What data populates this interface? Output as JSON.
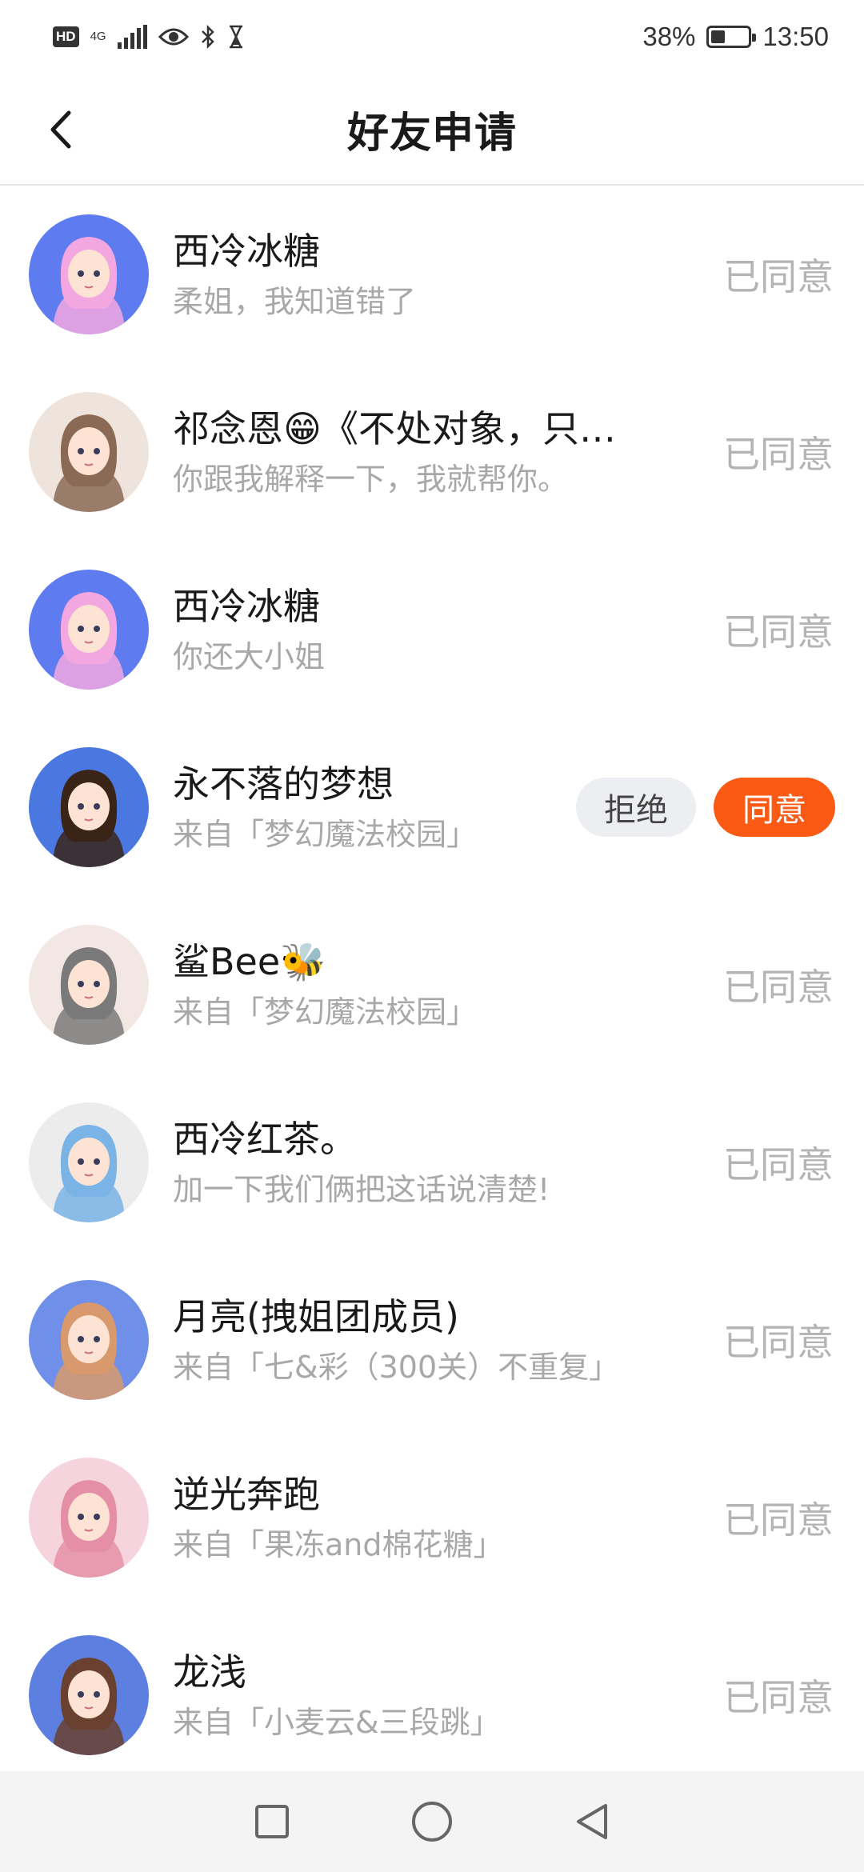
{
  "status_bar": {
    "hd": "HD",
    "net": "4G",
    "battery": "38%",
    "battery_level": 0.38,
    "time": "13:50"
  },
  "header": {
    "title": "好友申请",
    "back_icon": "chevron-left-icon"
  },
  "requests": [
    {
      "name": "西冷冰糖",
      "message": "柔姐，我知道错了",
      "status": "已同意",
      "avatar_colors": [
        "#5f7bf0",
        "#f2a7e1"
      ]
    },
    {
      "name": "祁念恩😁《不处对象，只…",
      "message": "你跟我解释一下，我就帮你。",
      "status": "已同意",
      "avatar_colors": [
        "#efe4dc",
        "#8a6a55"
      ]
    },
    {
      "name": "西冷冰糖",
      "message": "你还大小姐",
      "status": "已同意",
      "avatar_colors": [
        "#5f7bf0",
        "#f2a7e1"
      ]
    },
    {
      "name": "永不落的梦想",
      "message": "来自「梦幻魔法校园」",
      "reject_label": "拒绝",
      "agree_label": "同意",
      "avatar_colors": [
        "#4a78e0",
        "#3a2418"
      ]
    },
    {
      "name": "鲨Bee🐝",
      "message": "来自「梦幻魔法校园」",
      "status": "已同意",
      "avatar_colors": [
        "#f3e7e4",
        "#7a7a7a"
      ]
    },
    {
      "name": "西冷红茶。",
      "message": "加一下我们俩把这话说清楚!",
      "status": "已同意",
      "avatar_colors": [
        "#ececec",
        "#7ab3e6"
      ]
    },
    {
      "name": "月亮(拽姐团成员)",
      "message": "来自「七&彩（300关）不重复」",
      "status": "已同意",
      "avatar_colors": [
        "#6f8fe8",
        "#d89a6c"
      ]
    },
    {
      "name": "逆光奔跑",
      "message": "来自「果冻and棉花糖」",
      "status": "已同意",
      "avatar_colors": [
        "#f6d4de",
        "#e58fa6"
      ]
    },
    {
      "name": "龙浅",
      "message": "来自「小麦云&三段跳」",
      "status": "已同意",
      "avatar_colors": [
        "#5c7fe0",
        "#6a4130"
      ]
    }
  ],
  "nav_bar": {
    "recent_icon": "square-icon",
    "home_icon": "circle-icon",
    "back_icon": "triangle-back-icon"
  }
}
